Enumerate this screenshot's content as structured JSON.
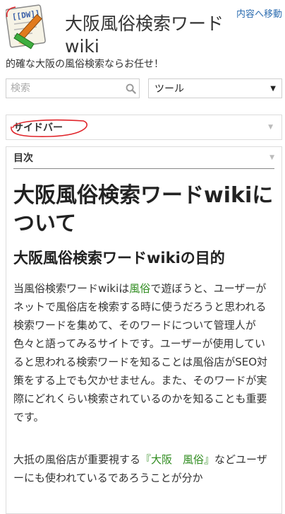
{
  "header": {
    "skip_link": "内容へ移動",
    "logo_text": "[[DW]]",
    "site_title": "大阪風俗検索ワードwiki",
    "tagline": "的確な大阪の風俗検索ならお任せ！"
  },
  "search": {
    "placeholder": "検索"
  },
  "tools": {
    "selected": "ツール"
  },
  "sidebar": {
    "title": "サイドバー"
  },
  "toc": {
    "title": "目次"
  },
  "article": {
    "h1": "大阪風俗検索ワードwikiについて",
    "h2": "大阪風俗検索ワードwikiの目的",
    "p1_a": "当風俗検索ワードwikiは",
    "p1_link": "風俗",
    "p1_b": "で遊ぼうと、ユーザーがネットで風俗店を検索する時に使うだろうと思われる検索ワードを集めて、そのワードについて管理人が色々と語ってみるサイトです。ユーザーが使用していると思われる検索ワードを知ることは風俗店がSEO対策をする上でも欠かせません。また、そのワードが実際にどれくらい検索されているのかを知ることも重要です。",
    "p2_a": "大抵の風俗店が重要視する",
    "p2_link": "『大阪　風俗』",
    "p2_b": "などユーザーにも使われているであろうことが分か"
  },
  "colors": {
    "link": "#2e8b1e",
    "skip_link": "#2b6cb0",
    "annotation": "#e0242a"
  }
}
